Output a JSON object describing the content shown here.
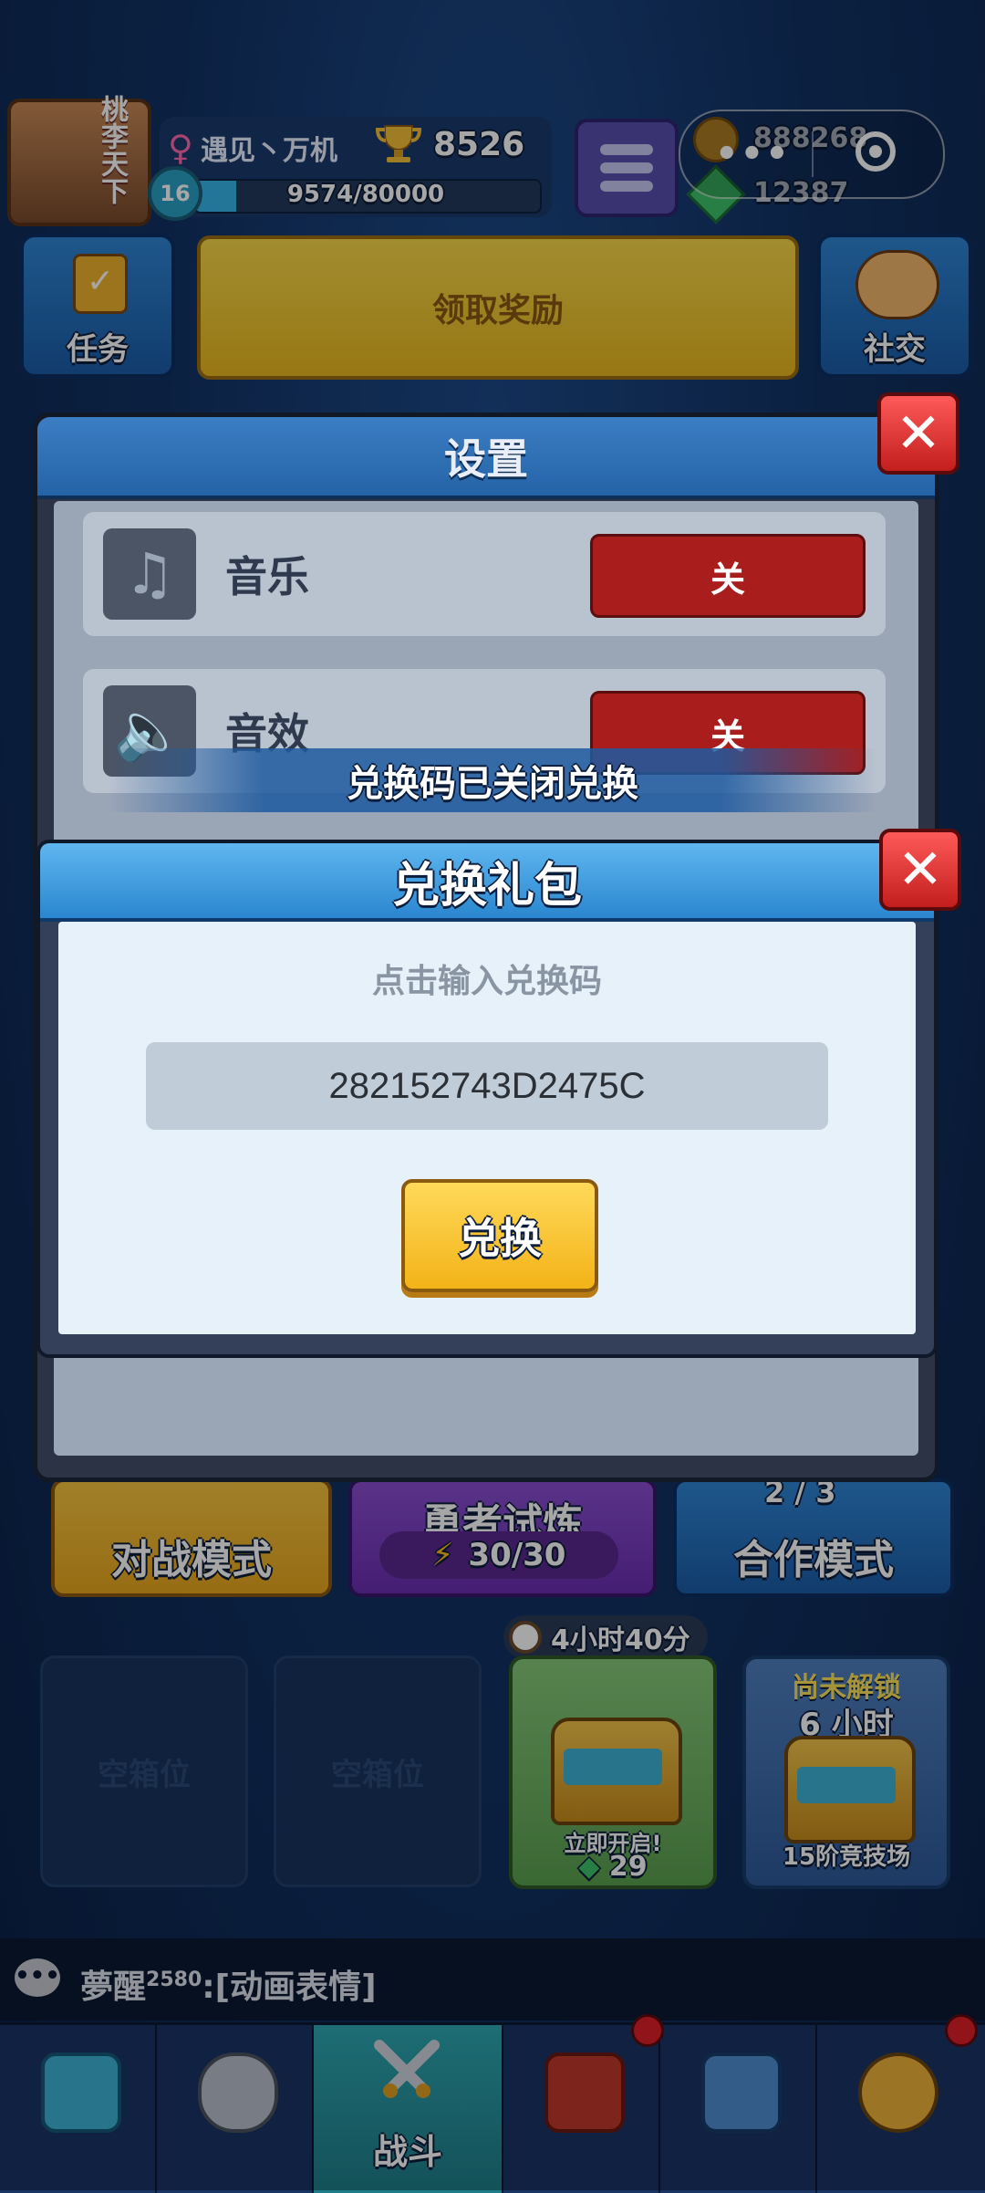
{
  "top_bar": {
    "avatar_deco": "桃李天下",
    "player_name": "遇见丶万机",
    "gender_symbol": "♀",
    "trophies": "8526",
    "level": "16",
    "xp_text": "9574/80000",
    "xp_fraction": 0.12,
    "coins": "888268",
    "gems": "12387"
  },
  "row2": {
    "task_label": "任务",
    "reward_label": "领取奖励",
    "social_label": "社交"
  },
  "settings": {
    "title": "设置",
    "rows": [
      {
        "label": "音乐",
        "toggle": "关",
        "icon": "music-icon"
      },
      {
        "label": "音效",
        "toggle": "关",
        "icon": "speaker-icon"
      }
    ]
  },
  "toast": "兑换码已关闭兑换",
  "gift_dialog": {
    "title": "兑换礼包",
    "hint": "点击输入兑换码",
    "code": "282152743D2475C",
    "redeem_label": "兑换"
  },
  "modes": {
    "fight": "对战模式",
    "trial": "勇者试炼",
    "trial_energy": "30/30",
    "coop": "合作模式",
    "coop_count": "2 / 3"
  },
  "chests": {
    "slot1": "空箱位",
    "slot2": "空箱位",
    "timer": "4小时40分",
    "open_now": "立即开启!",
    "open_cost": "29",
    "locked_label": "尚未解锁",
    "locked_duration": "6 小时",
    "locked_source": "15阶竞技场"
  },
  "chat": {
    "sender": "夢醒",
    "sup": "2580",
    "message": ":[动画表情]"
  },
  "nav": {
    "active_label": "战斗"
  },
  "colors": {
    "background": "#123366",
    "toggle_off": "#a91d1d",
    "redeem_button": "#f3b318",
    "close_button": "#c21e1e"
  }
}
